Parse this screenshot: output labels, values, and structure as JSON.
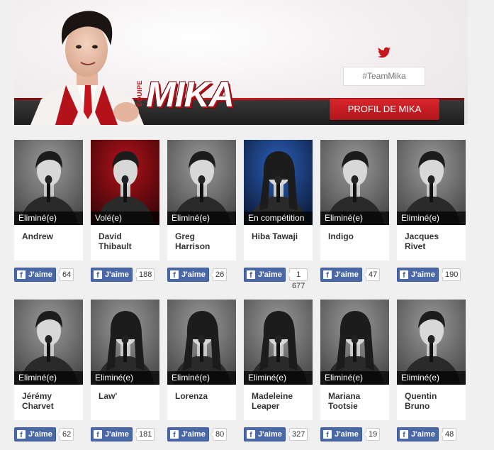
{
  "header": {
    "team_prefix": "ÉQUIPE",
    "team_name": "MIKA",
    "hashtag": "#TeamMika",
    "profile_button": "PROFIL DE MIKA"
  },
  "like_label": "J'aime",
  "colors": {
    "accent": "#c4161c",
    "facebook": "#4a67a6"
  },
  "candidates": [
    {
      "name": "Andrew",
      "status": "Eliminé(e)",
      "likes": "64",
      "bg": "gray"
    },
    {
      "name": "David Thibault",
      "status": "Volé(e)",
      "likes": "188",
      "bg": "red"
    },
    {
      "name": "Greg Harrison",
      "status": "Eliminé(e)",
      "likes": "26",
      "bg": "gray"
    },
    {
      "name": "Hiba Tawaji",
      "status": "En compétition",
      "likes": "1 677",
      "bg": "blue"
    },
    {
      "name": "Indigo",
      "status": "Eliminé(e)",
      "likes": "47",
      "bg": "gray"
    },
    {
      "name": "Jacques Rivet",
      "status": "Eliminé(e)",
      "likes": "190",
      "bg": "gray"
    },
    {
      "name": "Jérémy Charvet",
      "status": "Eliminé(e)",
      "likes": "62",
      "bg": "gray"
    },
    {
      "name": "Law'",
      "status": "Eliminé(e)",
      "likes": "181",
      "bg": "gray"
    },
    {
      "name": "Lorenza",
      "status": "Eliminé(e)",
      "likes": "80",
      "bg": "gray"
    },
    {
      "name": "Madeleine Leaper",
      "status": "Eliminé(e)",
      "likes": "327",
      "bg": "gray"
    },
    {
      "name": "Mariana Tootsie",
      "status": "Eliminé(e)",
      "likes": "19",
      "bg": "gray"
    },
    {
      "name": "Quentin Bruno",
      "status": "Eliminé(e)",
      "likes": "48",
      "bg": "gray"
    }
  ]
}
